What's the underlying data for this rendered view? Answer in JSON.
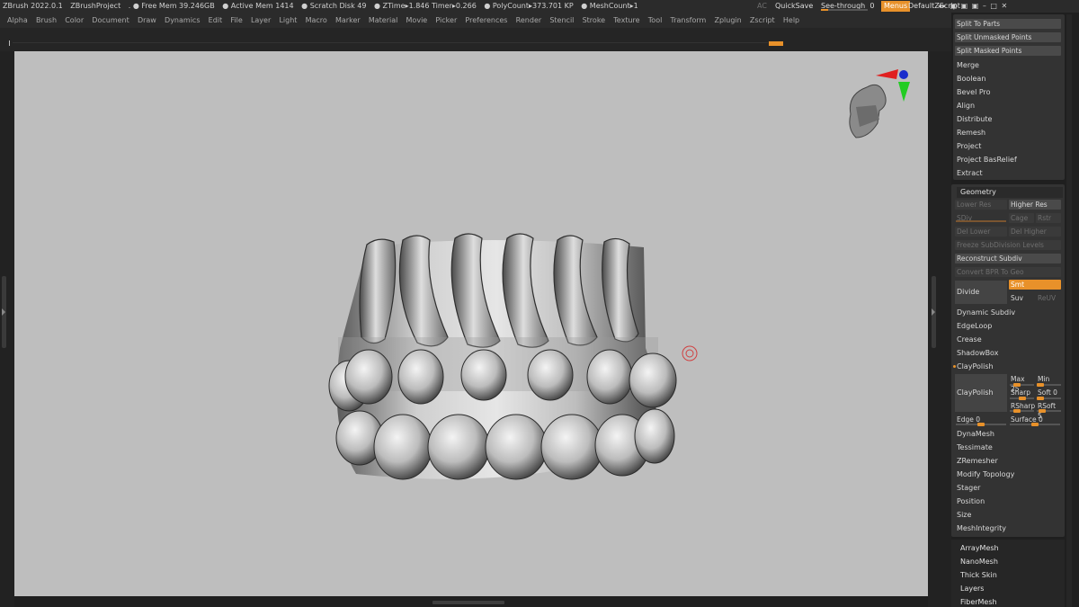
{
  "titlebar": {
    "app": "ZBrush 2022.0.1",
    "project": "ZBrushProject",
    "free_mem": ". ● Free Mem 39.246GB",
    "active_mem": "● Active Mem 1414",
    "scratch": "● Scratch Disk 49",
    "ztime": "● ZTime▸1.846 Timer▸0.266",
    "polycount": "● PolyCount▸373.701 KP",
    "meshcount": "● MeshCount▸1",
    "ac": "AC",
    "quicksave": "QuickSave",
    "see_through_label": "See-through",
    "see_through_value": "0",
    "see_through_level": 0.15,
    "menus": "Menus",
    "default_script": "DefaultZScript",
    "window_icons": "◂▸ ▣ ▣ ▣ – □ ✕"
  },
  "menubar": [
    "Alpha",
    "Brush",
    "Color",
    "Document",
    "Draw",
    "Dynamics",
    "Edit",
    "File",
    "Layer",
    "Light",
    "Macro",
    "Marker",
    "Material",
    "Movie",
    "Picker",
    "Preferences",
    "Render",
    "Stencil",
    "Stroke",
    "Texture",
    "Tool",
    "Transform",
    "Zplugin",
    "Zscript",
    "Help"
  ],
  "subtool_actions": [
    "Split To Parts",
    "Split Unmasked Points",
    "Split Masked Points"
  ],
  "subtool_items": [
    "Merge",
    "Boolean",
    "Bevel Pro",
    "Align",
    "Distribute",
    "Remesh",
    "Project",
    "Project BasRelief",
    "Extract"
  ],
  "geometry": {
    "header": "Geometry",
    "lower_res": "Lower Res",
    "higher_res": "Higher Res",
    "sdiv": "SDiv",
    "cage": "Cage",
    "rstr": "Rstr",
    "del_lower": "Del Lower",
    "del_higher": "Del Higher",
    "freeze": "Freeze SubDivision Levels",
    "reconstruct": "Reconstruct Subdiv",
    "convert_bpr": "Convert BPR To Geo",
    "divide": "Divide",
    "smt": "Smt",
    "suv": "Suv",
    "reuv": "ReUV",
    "dynamic_subdiv": "Dynamic Subdiv",
    "edgeloop": "EdgeLoop",
    "crease": "Crease",
    "shadowbox": "ShadowBox",
    "claypolish": "ClayPolish",
    "claypolish_btn": "ClayPolish",
    "max": "Max 25",
    "min": "Min",
    "sharp": "Sharp",
    "soft": "Soft 0",
    "rsharp": "RSharp",
    "rsoft": "RSoft 5",
    "edge": "Edge 0",
    "surface": "Surface 0",
    "rest": [
      "DynaMesh",
      "Tessimate",
      "ZRemesher",
      "Modify Topology",
      "Stager",
      "Position",
      "Size",
      "MeshIntegrity"
    ]
  },
  "bottom_items": [
    "ArrayMesh",
    "NanoMesh",
    "Thick Skin",
    "Layers",
    "FiberMesh"
  ],
  "colors": {
    "accent": "#e8912a",
    "canvas": "#bebebe",
    "panel": "#333333",
    "background": "#1f1f1f"
  }
}
